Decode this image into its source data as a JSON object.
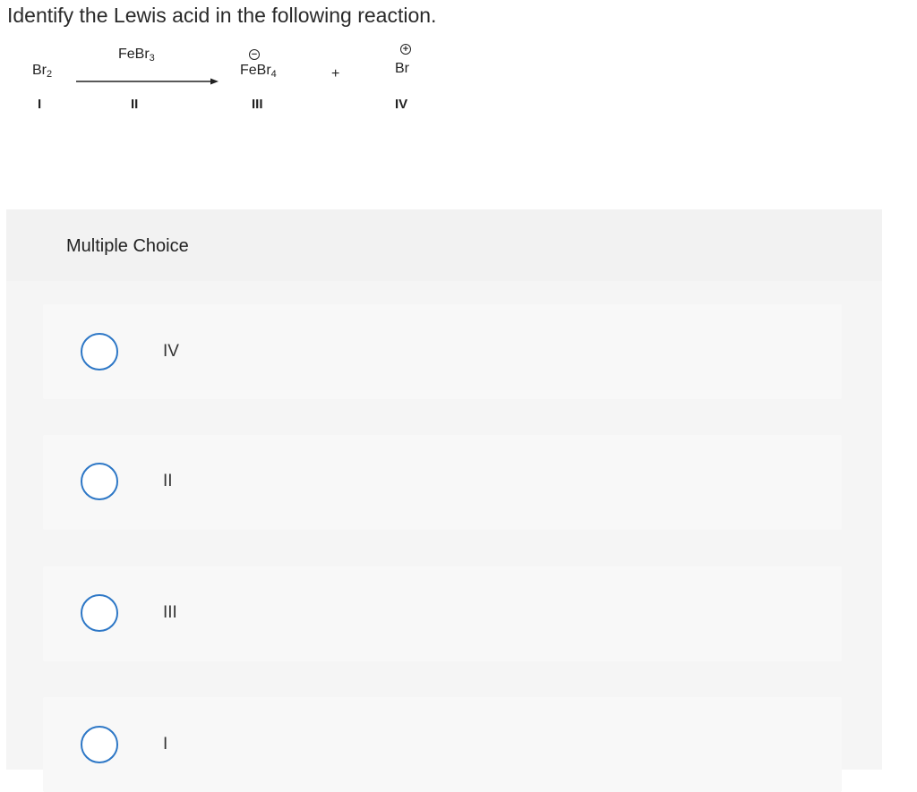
{
  "question": "Identify the Lewis acid in the following reaction.",
  "reaction": {
    "reactant": {
      "text": "Br",
      "sub": "2",
      "numeral": "I"
    },
    "catalyst": {
      "text": "FeBr",
      "sub": "3",
      "numeral": "II"
    },
    "product1": {
      "text": "FeBr",
      "sub": "4",
      "charge": "−",
      "numeral": "III"
    },
    "plus": "+",
    "product2": {
      "text": "Br",
      "charge": "+",
      "numeral": "IV"
    }
  },
  "multiple_choice": {
    "title": "Multiple Choice",
    "options": [
      {
        "label": "IV"
      },
      {
        "label": "II"
      },
      {
        "label": "III"
      },
      {
        "label": "I"
      }
    ],
    "radio_color": "#2d77c6"
  }
}
